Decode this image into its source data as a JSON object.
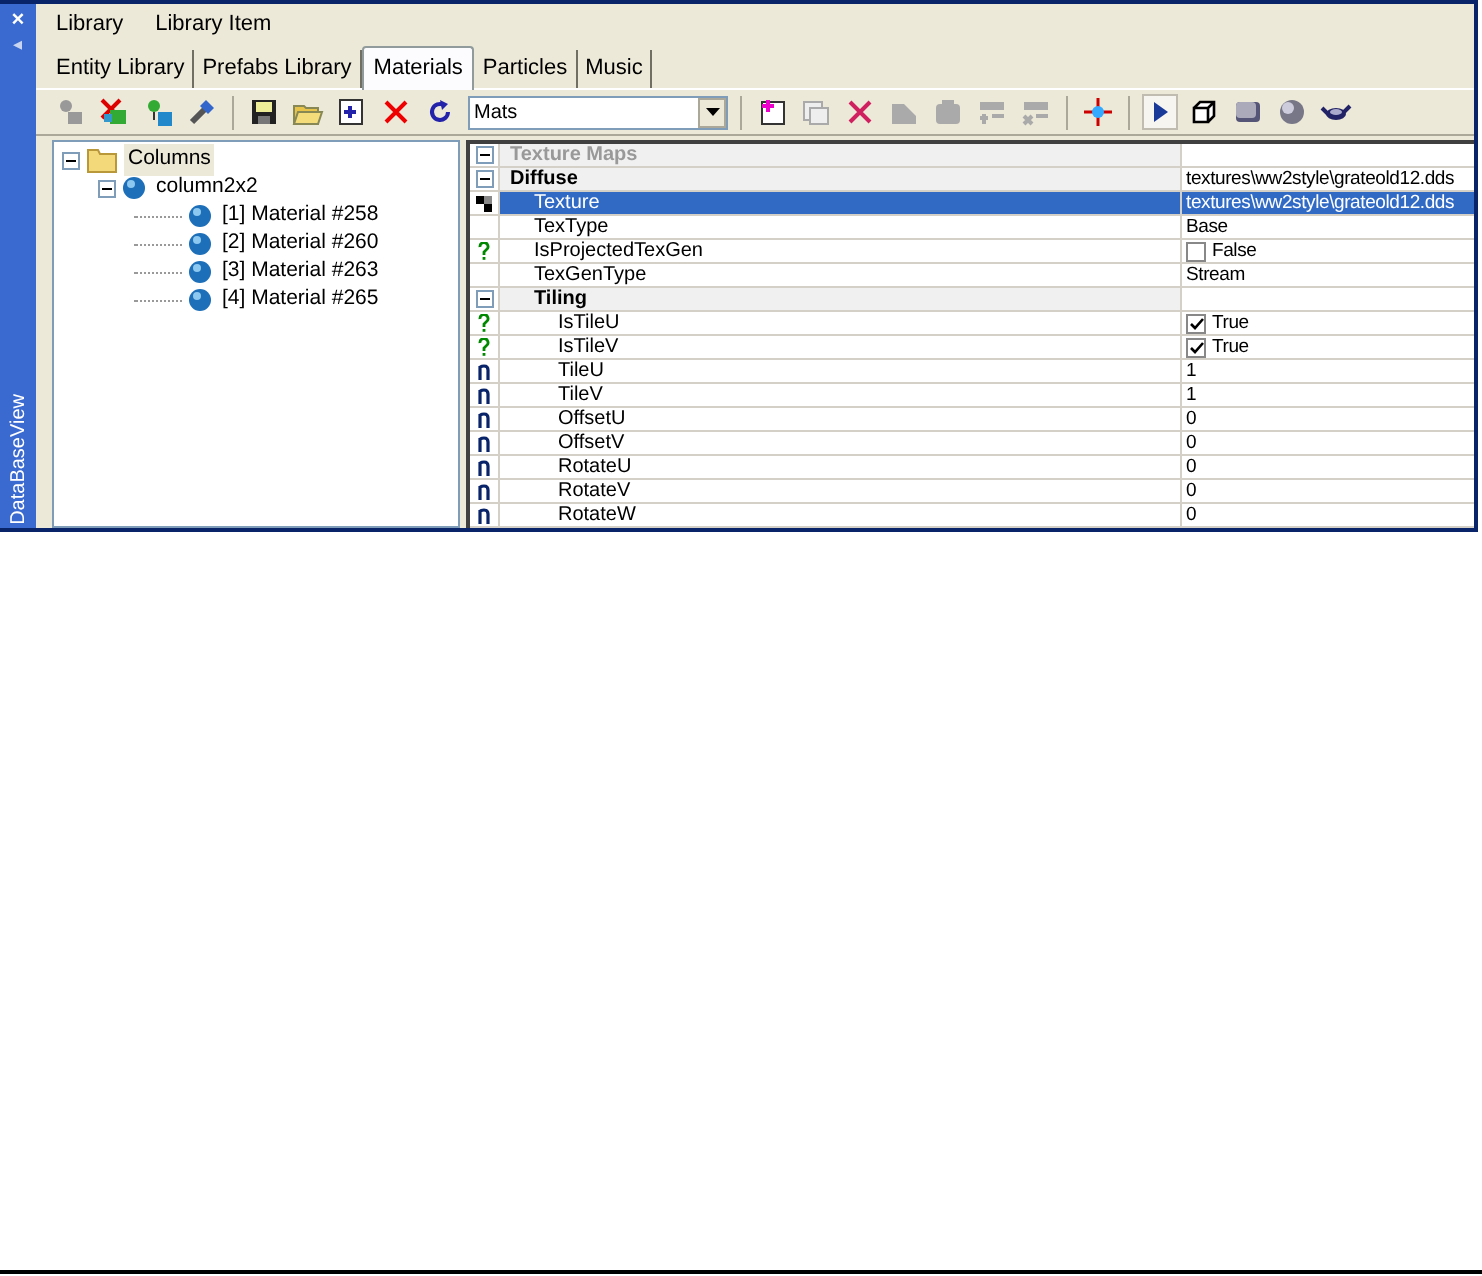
{
  "side_panel": {
    "close": "×",
    "pin": "◂",
    "title": "DataBaseView"
  },
  "menu": [
    "Library",
    "Library Item"
  ],
  "tabs": [
    {
      "label": "Entity Library",
      "selected": false
    },
    {
      "label": "Prefabs Library",
      "selected": false
    },
    {
      "label": "Materials",
      "selected": true
    },
    {
      "label": "Particles",
      "selected": false
    },
    {
      "label": "Music",
      "selected": false
    }
  ],
  "toolbar": {
    "filter": "Mats"
  },
  "tree": [
    {
      "label": "Columns",
      "kind": "folder",
      "expanded": true,
      "selected": true,
      "children": [
        {
          "label": "column2x2",
          "kind": "object",
          "expanded": true,
          "selected": false,
          "children": [
            {
              "label": "[1] Material #258",
              "kind": "material",
              "selected": false
            },
            {
              "label": "[2] Material #260",
              "kind": "material",
              "selected": false
            },
            {
              "label": "[3] Material #263",
              "kind": "material",
              "selected": false
            },
            {
              "label": "[4] Material #265",
              "kind": "material",
              "selected": false
            }
          ]
        }
      ]
    }
  ],
  "properties": [
    {
      "kind": "group",
      "name": "Texture Maps",
      "expanded": true,
      "children": [
        {
          "kind": "group",
          "name": "Diffuse",
          "value": "textures\\ww2style\\grateold12.dds",
          "expanded": true,
          "children": [
            {
              "kind": "texture",
              "name": "Texture",
              "value": "textures\\ww2style\\grateold12.dds",
              "selected": true
            },
            {
              "kind": "plain",
              "name": "TexType",
              "value": "Base",
              "selected": false
            },
            {
              "kind": "boolean",
              "name": "IsProjectedTexGen",
              "value": "False",
              "checked": false,
              "selected": false
            },
            {
              "kind": "plain",
              "name": "TexGenType",
              "value": "Stream",
              "selected": false
            },
            {
              "kind": "group",
              "name": "Tiling",
              "expanded": true,
              "children": [
                {
                  "kind": "boolean",
                  "name": "IsTileU",
                  "value": "True",
                  "checked": true,
                  "selected": false
                },
                {
                  "kind": "boolean",
                  "name": "IsTileV",
                  "value": "True",
                  "checked": true,
                  "selected": false
                },
                {
                  "kind": "number",
                  "name": "TileU",
                  "value": "1",
                  "selected": false
                },
                {
                  "kind": "number",
                  "name": "TileV",
                  "value": "1",
                  "selected": false
                },
                {
                  "kind": "number",
                  "name": "OffsetU",
                  "value": "0",
                  "selected": false
                },
                {
                  "kind": "number",
                  "name": "OffsetV",
                  "value": "0",
                  "selected": false
                },
                {
                  "kind": "number",
                  "name": "RotateU",
                  "value": "0",
                  "selected": false
                },
                {
                  "kind": "number",
                  "name": "RotateV",
                  "value": "0",
                  "selected": false
                },
                {
                  "kind": "number",
                  "name": "RotateW",
                  "value": "0",
                  "selected": false
                }
              ]
            }
          ]
        }
      ]
    }
  ]
}
